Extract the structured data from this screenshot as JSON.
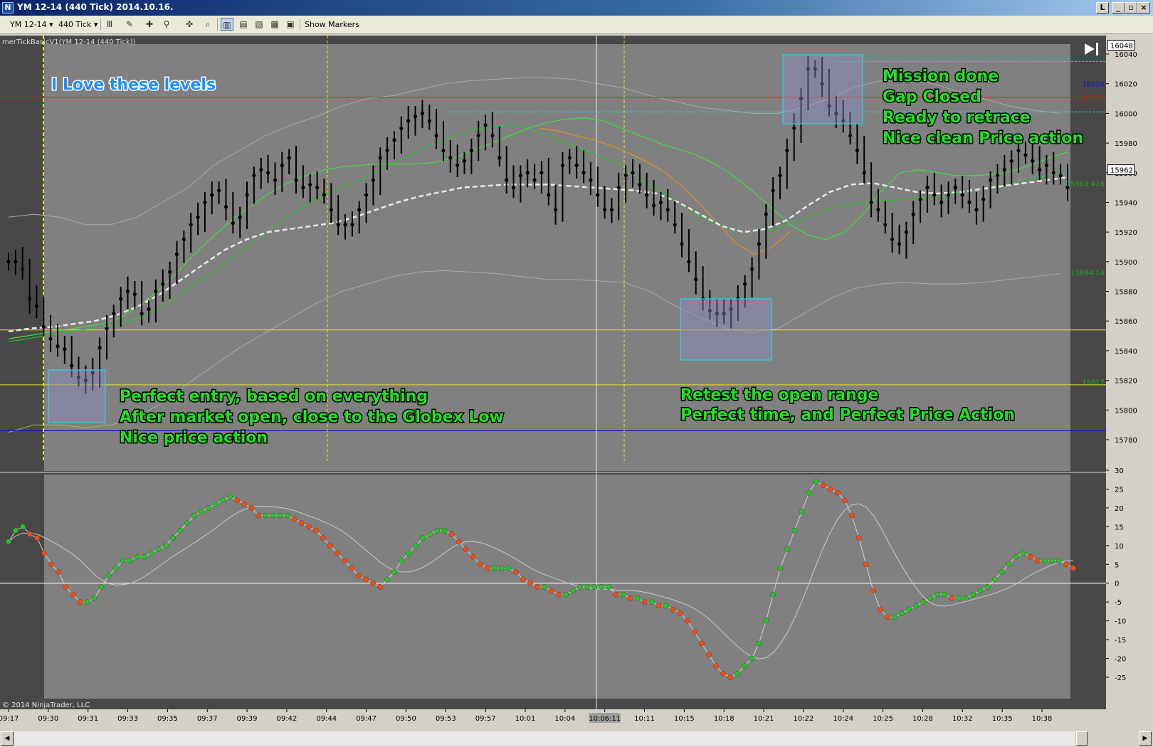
{
  "window": {
    "title": "YM 12-14 (440 Tick)  2014.10.16.",
    "buttons": [
      "L",
      "_",
      "▫",
      "×"
    ]
  },
  "toolbar": {
    "instrument": "YM 12-14",
    "interval": "440 Tick",
    "show_markers": "Show Markers"
  },
  "indicator_label": "merTickBasicV1(YM 12-14 (440 Tick))",
  "copyright": "© 2014 NinjaTrader, LLC",
  "cursor_time": "10:06:11",
  "colors": {
    "panel_bg": "#808080",
    "panel_dark": "#484848",
    "annotation_green": "#22e022",
    "annotation_blue": "#1e90ff",
    "red_level": "#e02020",
    "blue_level": "#1010c0",
    "yellow_level": "#e8e020",
    "cyan_box": "#30d0e0",
    "ma_green": "#22cc22",
    "ma_orange": "#e09020",
    "dot_green": "#22c822",
    "dot_red": "#ff4a10"
  },
  "annotations": {
    "love_levels": "I Love these levels",
    "entry": [
      "Perfect entry, based on everything",
      "After market open, close to the Globex Low",
      "Nice price action"
    ],
    "retest": [
      "Retest the open range",
      "Perfect time, and Perfect Price Action"
    ],
    "mission": [
      "Mission done",
      "Gap Closed",
      "Ready to retrace",
      "Nice clean Price action"
    ]
  },
  "price_axis": {
    "ticks": [
      "16040",
      "16020",
      "16000",
      "15980",
      "15960",
      "15940",
      "15920",
      "15900",
      "15880",
      "15860",
      "15840",
      "15820",
      "15800",
      "15780"
    ],
    "markers": [
      {
        "text": "16048",
        "price": 16046,
        "style": "box"
      },
      {
        "text": "15962",
        "price": 15962,
        "style": "box"
      },
      {
        "text": "16020",
        "price": 16020,
        "style": "blue"
      },
      {
        "text": "16011",
        "price": 16011,
        "style": "red"
      },
      {
        "text": "15963.416",
        "price": 15953,
        "style": "green"
      },
      {
        "text": "15894.14",
        "price": 15893,
        "style": "green"
      },
      {
        "text": "15817",
        "price": 15819,
        "style": "green"
      }
    ]
  },
  "osc_axis": {
    "ticks": [
      "30",
      "25",
      "20",
      "15",
      "10",
      "5",
      "0",
      "-5",
      "-10",
      "-15",
      "-20",
      "-25"
    ]
  },
  "time_axis": {
    "labels": [
      "09:17",
      "09:30",
      "09:31",
      "09:33",
      "09:35",
      "09:37",
      "09:39",
      "09:42",
      "09:44",
      "09:47",
      "09:50",
      "09:53",
      "09:57",
      "10:01",
      "10:04",
      "10:06:11",
      "10:11",
      "10:15",
      "10:18",
      "10:21",
      "10:22",
      "10:24",
      "10:25",
      "10:28",
      "10:32",
      "10:35",
      "10:38"
    ]
  },
  "chart_data": {
    "type": "line",
    "description_series": "price (OHLC bars approximated by closes) and oscillator",
    "price_ylim": [
      15770,
      16050
    ],
    "osc_ylim": [
      -27,
      31
    ],
    "levels": [
      {
        "name": "",
        "value": 16011,
        "color": "#e02020"
      },
      {
        "name": "",
        "value": 15854,
        "color": "#e8e020"
      },
      {
        "name": "",
        "value": 15817,
        "color": "#e8e020"
      },
      {
        "name": "",
        "value": 15786,
        "color": "#1010c0"
      }
    ],
    "price_close": [
      15900,
      15900,
      15895,
      15875,
      15870,
      15856,
      15848,
      15843,
      15841,
      15830,
      15822,
      15820,
      15825,
      15842,
      15855,
      15865,
      15875,
      15880,
      15878,
      15865,
      15868,
      15880,
      15885,
      15893,
      15905,
      15915,
      15925,
      15930,
      15940,
      15945,
      15948,
      15937,
      15926,
      15930,
      15945,
      15958,
      15962,
      15960,
      15955,
      15965,
      15970,
      15955,
      15950,
      15952,
      15950,
      15945,
      15935,
      15925,
      15925,
      15925,
      15935,
      15945,
      15955,
      15970,
      15975,
      15982,
      15990,
      15995,
      15998,
      16000,
      15995,
      15985,
      15975,
      15970,
      15965,
      15968,
      15975,
      15985,
      15992,
      15985,
      15970,
      15955,
      15950,
      15958,
      15960,
      15955,
      15960,
      15945,
      15935,
      15965,
      15970,
      15965,
      15960,
      15955,
      15945,
      15935,
      15935,
      15950,
      15958,
      15960,
      15952,
      15945,
      15938,
      15940,
      15935,
      15925,
      15912,
      15900,
      15888,
      15875,
      15867,
      15865,
      15865,
      15868,
      15875,
      15885,
      15895,
      15912,
      15932,
      15948,
      15958,
      15975,
      15990,
      16010,
      16030,
      16030,
      16020,
      16005,
      16000,
      15995,
      15985,
      15975,
      15960,
      15940,
      15935,
      15925,
      15915,
      15912,
      15920,
      15932,
      15942,
      15950,
      15945,
      15940,
      15945,
      15950,
      15945,
      15940,
      15935,
      15942,
      15955,
      15958,
      15962,
      15968,
      15975,
      15972,
      15968,
      15962,
      15965,
      15960,
      15958,
      15950
    ],
    "ma_green_short": [
      15848,
      15850,
      15852,
      15854,
      15856,
      15858,
      15862,
      15870,
      15880,
      15892,
      15905,
      15917,
      15928,
      15937,
      15946,
      15953,
      15958,
      15962,
      15964,
      15965,
      15966,
      15966,
      15966,
      15967,
      15970,
      15975,
      15980,
      15985,
      15990,
      15994,
      15996,
      15997,
      15995,
      15990,
      15985,
      15980,
      15976,
      15972,
      15966,
      15958,
      15948,
      15937,
      15926,
      15918,
      15915,
      15920,
      15932,
      15948,
      15960,
      15962,
      15960,
      15958,
      15958,
      15959,
      15961,
      15965,
      15970,
      15974
    ],
    "ma_green_long": [
      15846,
      15848,
      15850,
      15852,
      15854,
      15856,
      15858,
      15862,
      15868,
      15876,
      15885,
      15893,
      15902,
      15912,
      15920,
      15930,
      15938,
      15945,
      15950,
      15956,
      15962,
      15968,
      15974,
      15980,
      15985,
      15989,
      15991,
      15992,
      15990,
      15985,
      15980,
      15975,
      15970,
      15964,
      15956,
      15948,
      15940,
      15932,
      15926,
      15922,
      15920,
      15922,
      15925,
      15930,
      15935,
      15938,
      15940,
      15941,
      15942,
      15943,
      15944,
      15946,
      15948,
      15950,
      15953,
      15956,
      15958,
      15960
    ],
    "ma_orange": [
      15990,
      15988,
      15985,
      15982,
      15978,
      15973,
      15967,
      15960,
      15950,
      15938,
      15925,
      15912,
      15905,
      15910,
      15920
    ],
    "ma_white_dashed": [
      15853,
      15855,
      15856,
      15858,
      15860,
      15864,
      15870,
      15878,
      15888,
      15898,
      15908,
      15915,
      15920,
      15922,
      15924,
      15926,
      15930,
      15935,
      15940,
      15944,
      15947,
      15950,
      15951,
      15952,
      15952,
      15952,
      15951,
      15950,
      15949,
      15948,
      15946,
      15940,
      15932,
      15924,
      15920,
      15922,
      15928,
      15938,
      15947,
      15952,
      15953,
      15950,
      15947,
      15946,
      15947,
      15949,
      15951,
      15953,
      15955,
      15957
    ],
    "band_upper": [
      15930,
      15932,
      15930,
      15925,
      15925,
      15930,
      15940,
      15950,
      15965,
      15975,
      15985,
      15992,
      15998,
      16005,
      16010,
      16012,
      16016,
      16020,
      16022,
      16023,
      16024,
      16024,
      16023,
      16020,
      16017,
      16012,
      16008,
      16004,
      16002,
      16000,
      16000,
      16004,
      16010,
      16018,
      16022,
      16023,
      16020,
      16015,
      16010,
      16005,
      16002,
      16000
    ],
    "band_lower": [
      15785,
      15790,
      15790,
      15788,
      15790,
      15795,
      15805,
      15818,
      15830,
      15842,
      15852,
      15862,
      15872,
      15880,
      15885,
      15890,
      15893,
      15894,
      15893,
      15892,
      15890,
      15888,
      15888,
      15887,
      15886,
      15880,
      15870,
      15862,
      15855,
      15852,
      15855,
      15865,
      15875,
      15882,
      15885,
      15886,
      15885,
      15885,
      15886,
      15888,
      15890,
      15892
    ],
    "oscillator": [
      11,
      14,
      15,
      13,
      12,
      8,
      5,
      3,
      -1,
      -3,
      -5,
      -5,
      -4,
      -1,
      2,
      4,
      6,
      6,
      7,
      7,
      8,
      9,
      10,
      12,
      14,
      16,
      18,
      19,
      20,
      21,
      22,
      23,
      22,
      21,
      20,
      18,
      18,
      18,
      18,
      18,
      17,
      16,
      15,
      14,
      12,
      10,
      8,
      6,
      4,
      2,
      1,
      0,
      -1,
      1,
      3,
      6,
      8,
      10,
      12,
      13,
      14,
      14,
      13,
      11,
      9,
      7,
      5,
      4,
      4,
      4,
      4,
      3,
      1,
      0,
      -1,
      -1,
      -2,
      -3,
      -3,
      -2,
      -1,
      -1,
      -1,
      -1,
      -1,
      -3,
      -3,
      -4,
      -4,
      -5,
      -5,
      -6,
      -6,
      -7,
      -8,
      -10,
      -13,
      -16,
      -19,
      -22,
      -24,
      -25,
      -24,
      -22,
      -20,
      -16,
      -10,
      -3,
      4,
      9,
      14,
      19,
      24,
      27,
      26,
      25,
      24,
      22,
      18,
      12,
      5,
      -2,
      -7,
      -9,
      -9,
      -8,
      -7,
      -6,
      -5,
      -4,
      -3,
      -3,
      -4,
      -4,
      -4,
      -3,
      -2,
      -1,
      1,
      3,
      5,
      7,
      8,
      7,
      6,
      6,
      6,
      6,
      5,
      4
    ]
  }
}
